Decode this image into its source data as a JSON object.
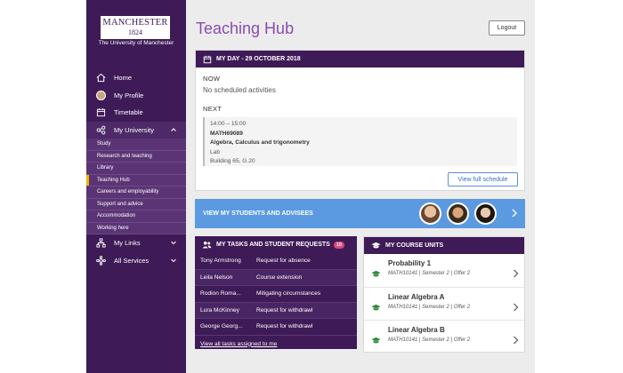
{
  "sidebar": {
    "logo_name": "MANCHESTER",
    "logo_year": "1824",
    "logo_sub": "The University of Manchester",
    "items": [
      {
        "label": "Home"
      },
      {
        "label": "My Profile"
      },
      {
        "label": "Timetable"
      },
      {
        "label": "My University"
      }
    ],
    "subitems": [
      {
        "label": "Study"
      },
      {
        "label": "Research and teaching"
      },
      {
        "label": "Library"
      },
      {
        "label": "Teaching Hub"
      },
      {
        "label": "Careers and employability"
      },
      {
        "label": "Support and advice"
      },
      {
        "label": "Accommodation"
      },
      {
        "label": "Working here"
      }
    ],
    "bottom_items": [
      {
        "label": "My Links"
      },
      {
        "label": "All Services"
      }
    ],
    "active_subitem": "Teaching Hub",
    "accent_color": "#f4b400"
  },
  "header": {
    "title": "Teaching Hub",
    "logout_label": "Logout"
  },
  "myday": {
    "heading": "MY DAY - 29 OCTOBER 2018",
    "now_label": "NOW",
    "now_text": "No scheduled activities",
    "next_label": "NEXT",
    "next": {
      "time": "14:00 – 15:00",
      "code": "MATH69089",
      "title": "Algebra, Calculus and trigonometry",
      "type": "Lab",
      "location": "Building 65, G.20"
    },
    "schedule_button": "View full schedule"
  },
  "students": {
    "label": "VIEW MY STUDENTS AND ADVISEES"
  },
  "tasks": {
    "heading": "MY TASKS AND STUDENT REQUESTS",
    "count": "10",
    "rows": [
      {
        "name": "Tony Armstrong",
        "request": "Request for absence"
      },
      {
        "name": "Leila Nelson",
        "request": "Course extension"
      },
      {
        "name": "Rodion Roma...",
        "request": "Mitigating circumstances"
      },
      {
        "name": "Lura McKinney",
        "request": "Request for withdrawl"
      },
      {
        "name": "George Georg...",
        "request": "Request for withdrawl"
      }
    ],
    "link": "View all tasks assigned to me"
  },
  "units": {
    "heading": "MY COURSE UNITS",
    "rows": [
      {
        "title": "Probability 1",
        "meta": "MATH10141 | Semester 2 | Offer 2"
      },
      {
        "title": "Linear Algebra A",
        "meta": "MATH10141 | Semester 2 | Offer 2"
      },
      {
        "title": "Linear Algebra B",
        "meta": "MATH10141 | Semester 2 | Offer 2"
      }
    ]
  },
  "colors": {
    "brand": "#3e1a57",
    "title": "#8a4bb0",
    "students_bar": "#5b9ae1",
    "badge": "#e0457b"
  }
}
